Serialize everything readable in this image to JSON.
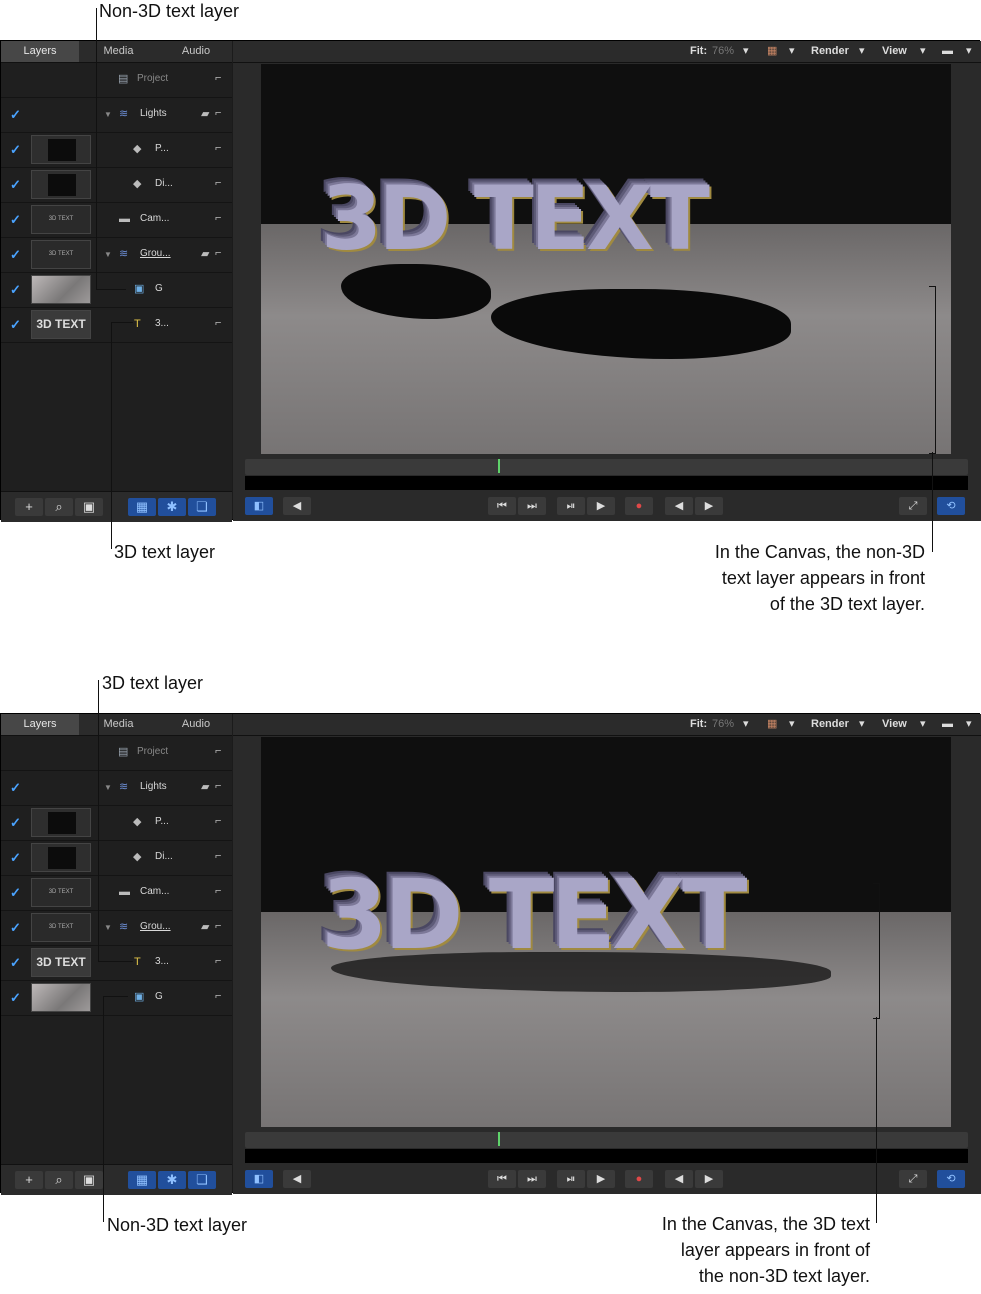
{
  "tabs": {
    "layers": "Layers",
    "media": "Media",
    "audio": "Audio"
  },
  "topbar": {
    "fit_label": "Fit:",
    "fit_value": "76%",
    "render": "Render",
    "view": "View"
  },
  "canvas_text": "3D TEXT",
  "panel1": {
    "layers": [
      {
        "name": "Project",
        "icon": "project-icon"
      },
      {
        "name": "Lights",
        "icon": "group-icon"
      },
      {
        "name": "P...",
        "icon": "light-icon"
      },
      {
        "name": "Di...",
        "icon": "light-icon"
      },
      {
        "name": "Cam...",
        "icon": "camera-icon"
      },
      {
        "name": "Grou...",
        "icon": "group-icon"
      },
      {
        "name": "G",
        "icon": "image-icon"
      },
      {
        "name": "3...",
        "icon": "text-icon"
      }
    ],
    "thumb_text_small": "3D TEXT",
    "thumb_text": "3D TEXT",
    "callout_top": "Non-3D text layer",
    "callout_bottom_left": "3D text layer",
    "callout_right": [
      "In the Canvas, the non-3D",
      "text layer appears in front",
      "of the 3D text layer."
    ]
  },
  "panel2": {
    "layers": [
      {
        "name": "Project",
        "icon": "project-icon"
      },
      {
        "name": "Lights",
        "icon": "group-icon"
      },
      {
        "name": "P...",
        "icon": "light-icon"
      },
      {
        "name": "Di...",
        "icon": "light-icon"
      },
      {
        "name": "Cam...",
        "icon": "camera-icon"
      },
      {
        "name": "Grou...",
        "icon": "group-icon"
      },
      {
        "name": "3...",
        "icon": "text-icon"
      },
      {
        "name": "G",
        "icon": "image-icon"
      }
    ],
    "thumb_text_small": "3D TEXT",
    "thumb_text": "3D TEXT",
    "callout_top": "3D text layer",
    "callout_bottom_left": "Non-3D text layer",
    "callout_right": [
      "In the Canvas, the 3D text",
      "layer appears in front of",
      "the non-3D text layer."
    ]
  }
}
